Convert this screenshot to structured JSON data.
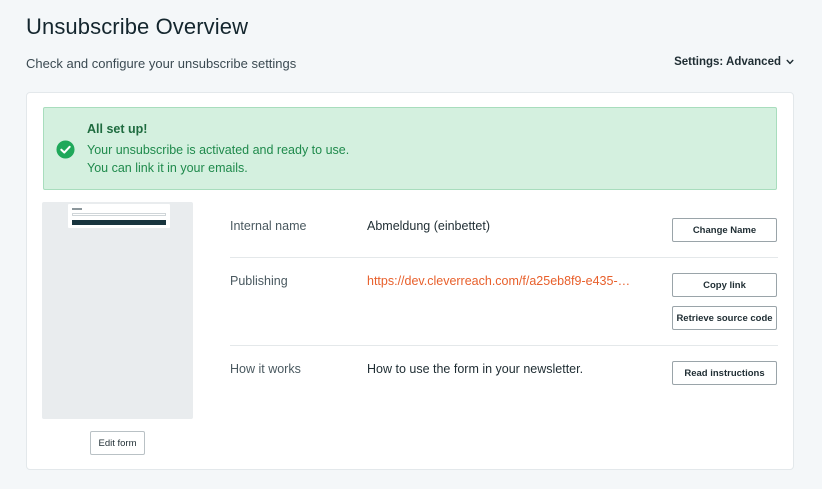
{
  "header": {
    "title": "Unsubscribe Overview",
    "subtitle": "Check and configure your unsubscribe settings",
    "settings_label": "Settings: Advanced"
  },
  "alert": {
    "title": "All set up!",
    "line1": "Your unsubscribe is activated and ready to use.",
    "line2": "You can link it in your emails.",
    "icon": "check-circle-icon",
    "color": "#1f8a4c"
  },
  "preview": {
    "edit_label": "Edit form"
  },
  "details": {
    "internal_name": {
      "label": "Internal name",
      "value": "Abmeldung (einbettet)",
      "button": "Change Name"
    },
    "publishing": {
      "label": "Publishing",
      "link": "https://dev.cleverreach.com/f/a25eb8f9-e435-…",
      "copy_button": "Copy link",
      "source_button": "Retrieve source code"
    },
    "how_it_works": {
      "label": "How it works",
      "value": "How to use the form in your newsletter.",
      "button": "Read instructions"
    }
  },
  "colors": {
    "accent_link": "#e8602c",
    "success_bg": "#d4f0df"
  }
}
